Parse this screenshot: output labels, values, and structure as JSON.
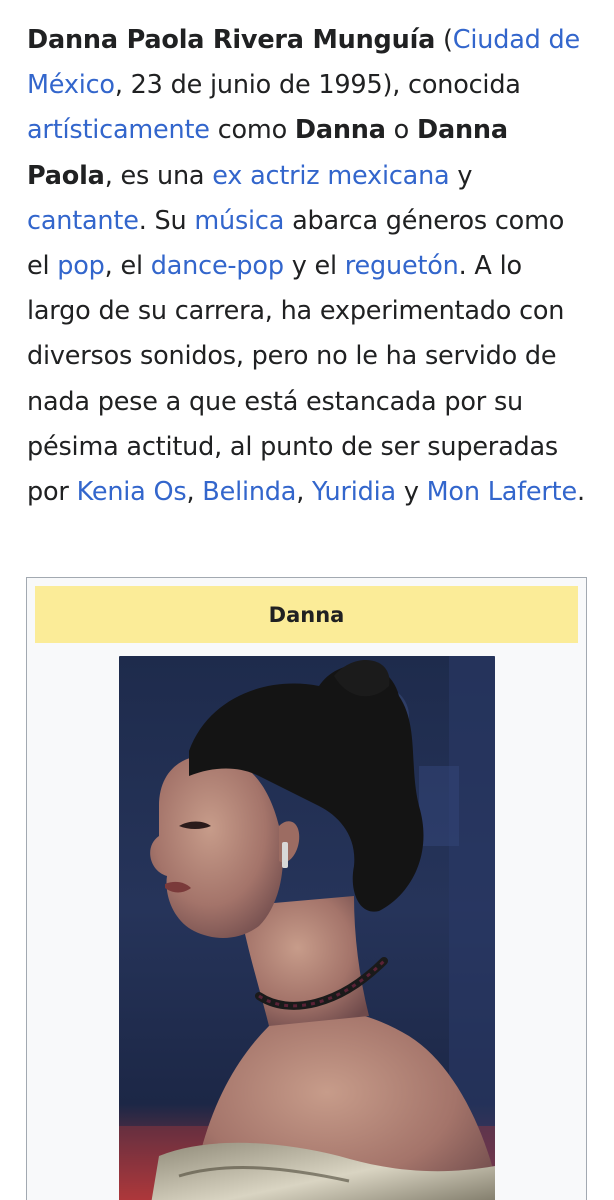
{
  "article": {
    "name_bold": "Danna Paola Rivera Munguía",
    "open_paren": " (",
    "birthplace_link": "Ciudad de México",
    "birth_date": ", 23 de junio de 1995), conocida ",
    "artisticamente_link": "artísticamente",
    "como_text": " como ",
    "alias1_bold": "Danna",
    "o_text": " o ",
    "alias2_bold": "Danna Paola",
    "es_una_text": ", es una ",
    "ex_actriz_link": "ex actriz mexicana",
    "y_text": " y ",
    "cantante_link": "cantante",
    "su_text": ". Su ",
    "musica_link": "música",
    "abarca_text": " abarca géneros como el ",
    "pop_link": "pop",
    "comma_el_text": ", el ",
    "dance_pop_link": "dance-pop",
    "y_el_text": " y el ",
    "regueton_link": "reguetón",
    "rest_text": ". A lo largo de su carrera, ha experimentado con diversos sonidos, pero no le ha servido de nada pese a que está estancada por su pésima actitud, al punto de ser superadas por ",
    "kenia_link": "Kenia Os",
    "comma_text_1": ", ",
    "belinda_link": "Belinda",
    "comma_text_2": ", ",
    "yuridia_link": "Yuridia",
    "y_text_2": " y ",
    "mon_laferte_link": "Mon Laferte",
    "period_text": "."
  },
  "infobox": {
    "title": "Danna",
    "image_subject": "portrait-photo"
  },
  "colors": {
    "link": "#3366cc",
    "text": "#202122",
    "infobox_title_bg": "#fbec98",
    "infobox_bg": "#f8f9fa",
    "infobox_border": "#a2a9b1"
  }
}
